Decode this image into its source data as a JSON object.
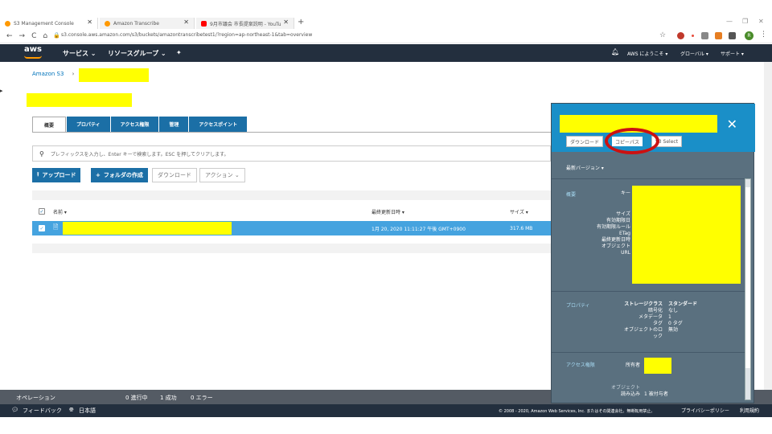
{
  "browser": {
    "tabs": [
      {
        "title": "S3 Management Console",
        "color": "#ff9900"
      },
      {
        "title": "Amazon Transcribe",
        "color": "#ff9900"
      },
      {
        "title": "9月市議会 市長提案説明 - YouTu",
        "color": "#ff0000"
      }
    ],
    "new_tab": "+",
    "url": "s3.console.aws.amazon.com/s3/buckets/amazontranscribetest1/?region=ap-northeast-1&tab=overview",
    "avatar_letter": "R"
  },
  "aws_header": {
    "logo": "aws",
    "services": "サービス ⌄",
    "resource_groups": "リソースグループ ⌄",
    "pin": "✦",
    "bell": "🔔",
    "welcome": "AWS にようこそ ▾",
    "region": "グローバル ▾",
    "support": "サポート ▾"
  },
  "breadcrumb": {
    "root": "Amazon S3",
    "sep": "›"
  },
  "tabs": [
    "概要",
    "プロパティ",
    "アクセス権限",
    "管理",
    "アクセスポイント"
  ],
  "search": {
    "placeholder": "プレフィックスを入力し、Enter キーで検索します。ESC を押してクリアします。"
  },
  "toolbar": {
    "upload": "アップロード",
    "create_folder": "フォルダの作成",
    "download": "ダウンロード",
    "actions": "アクション ⌄"
  },
  "table": {
    "col_name": "名前 ▾",
    "col_modified": "最終更新日時 ▾",
    "col_size": "サイズ ▾",
    "rows": [
      {
        "modified": "1月 20, 2020 11:11:27 午後 GMT+0900",
        "size": "317.6 MB",
        "selected": true
      }
    ]
  },
  "opbar": {
    "label": "オペレーション",
    "in_progress": "0 進行中",
    "success": "1 成功",
    "error": "0 エラー"
  },
  "footer": {
    "feedback": "フィードバック",
    "language": "日本語",
    "copyright": "© 2008 - 2020, Amazon Web Services, Inc. またはその関連会社。無断転用禁止。",
    "privacy": "プライバシーポリシー",
    "terms": "利用規約"
  },
  "panel": {
    "buttons": {
      "download": "ダウンロード",
      "copy_path": "コピーパス",
      "s3select": "S3 Select"
    },
    "latest_version": "最新バージョン ▾",
    "overview": {
      "label": "概要",
      "key": "キー",
      "size": "サイズ",
      "expiry_date": "有効期限日",
      "expiry_rule": "有効期限ルール",
      "etag": "ETag",
      "last_modified": "最終更新日時",
      "object_url": "オブジェクト URL"
    },
    "properties": {
      "label": "プロパティ",
      "storage_class_k": "ストレージクラス",
      "storage_class_v": "スタンダード",
      "encryption_k": "暗号化",
      "encryption_v": "なし",
      "metadata_k": "メタデータ",
      "metadata_v": "1",
      "tags_k": "タグ",
      "tags_v": "0 タグ",
      "lock_k": "オブジェクトのロック",
      "lock_v": "無効"
    },
    "access": {
      "label": "アクセス権限",
      "owner": "所有者",
      "object_k": "オブジェクト",
      "read_k": "読み込み",
      "read_v": "1 被付与者"
    }
  }
}
